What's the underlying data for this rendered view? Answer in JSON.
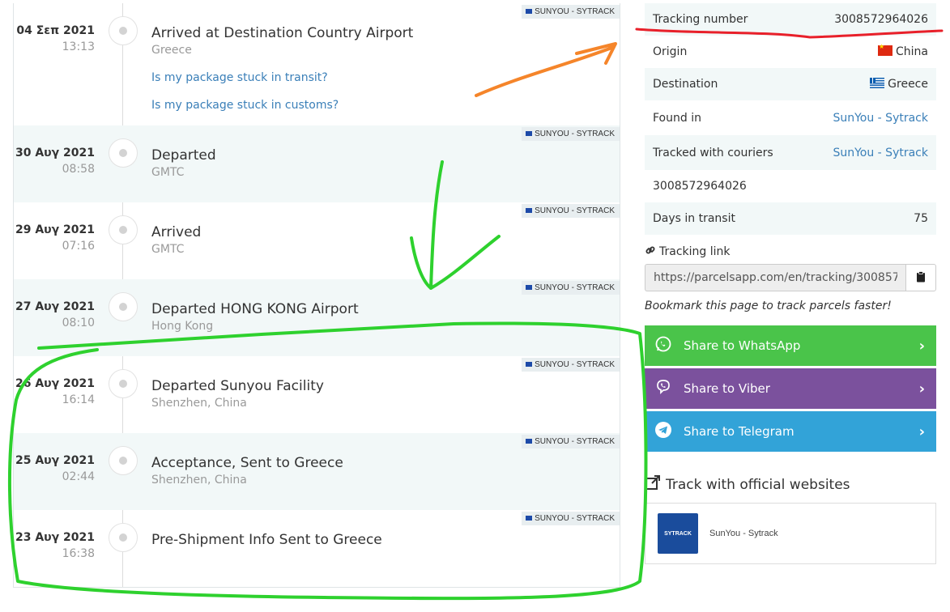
{
  "timeline": {
    "badge_label": "SUNYOU - SYTRACK",
    "events": [
      {
        "date": "04 Σεπ 2021",
        "time": "13:13",
        "title": "Arrived at Destination Country Airport",
        "location": "Greece"
      },
      {
        "date": "30 Αυγ 2021",
        "time": "08:58",
        "title": "Departed",
        "location": "GMTC"
      },
      {
        "date": "29 Αυγ 2021",
        "time": "07:16",
        "title": "Arrived",
        "location": "GMTC"
      },
      {
        "date": "27 Αυγ 2021",
        "time": "08:10",
        "title": "Departed HONG KONG Airport",
        "location": "Hong Kong"
      },
      {
        "date": "26 Αυγ 2021",
        "time": "16:14",
        "title": "Departed Sunyou Facility",
        "location": "Shenzhen, China"
      },
      {
        "date": "25 Αυγ 2021",
        "time": "02:44",
        "title": "Acceptance, Sent to Greece",
        "location": "Shenzhen, China"
      },
      {
        "date": "23 Αυγ 2021",
        "time": "16:38",
        "title": "Pre-Shipment Info Sent to Greece",
        "location": ""
      }
    ],
    "links": {
      "transit": "Is my package stuck in transit?",
      "customs": "Is my package stuck in customs?"
    }
  },
  "info": {
    "tracking_label": "Tracking number",
    "tracking_value": "3008572964026",
    "origin_label": "Origin",
    "origin_value": "China",
    "destination_label": "Destination",
    "destination_value": "Greece",
    "found_label": "Found in",
    "found_value": "SunYou - Sytrack",
    "couriers_label": "Tracked with couriers",
    "couriers_value": "SunYou - Sytrack",
    "extra_number": "3008572964026",
    "days_label": "Days in transit",
    "days_value": "75"
  },
  "tracking_link": {
    "label": "Tracking link",
    "url": "https://parcelsapp.com/en/tracking/3008572964026",
    "bookmark": "Bookmark this page to track parcels faster!"
  },
  "share": {
    "whatsapp": "Share to WhatsApp",
    "viber": "Share to Viber",
    "telegram": "Share to Telegram"
  },
  "official": {
    "heading": "Track with official websites",
    "logo_text": "SYTRACK",
    "name": "SunYou - Sytrack"
  },
  "colors": {
    "accent_link": "#3a7fb8",
    "whatsapp": "#4ac44a",
    "viber": "#7b519d",
    "telegram": "#32a3d8",
    "annotation_red": "#e8202a",
    "annotation_orange": "#f5852a",
    "annotation_green": "#2ed12e"
  }
}
